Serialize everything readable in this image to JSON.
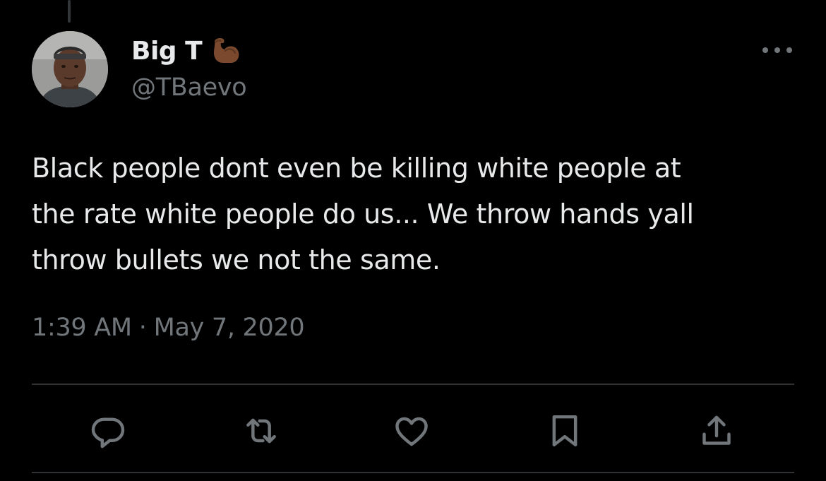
{
  "tweet": {
    "author": {
      "display_name": "Big T",
      "handle": "@TBaevo",
      "badge_emoji": "flexed-biceps-icon"
    },
    "text": "Black people dont even be killing white people at\nthe rate white people do us... We throw hands yall\nthrow bullets we not the same.",
    "time": "1:39 AM",
    "separator": "·",
    "date": "May 7, 2020"
  },
  "actions": [
    {
      "name": "reply",
      "icon": "reply-icon"
    },
    {
      "name": "retweet",
      "icon": "retweet-icon"
    },
    {
      "name": "like",
      "icon": "heart-icon"
    },
    {
      "name": "bookmark",
      "icon": "bookmark-icon"
    },
    {
      "name": "share",
      "icon": "share-icon"
    }
  ],
  "colors": {
    "background": "#000000",
    "primary_text": "#e7e9ea",
    "secondary_text": "#71767b",
    "divider": "#2f3336"
  }
}
